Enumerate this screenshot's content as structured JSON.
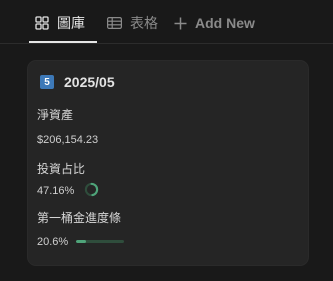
{
  "tabs": [
    {
      "label": "圖庫",
      "icon": "gallery-grid-icon",
      "active": true
    },
    {
      "label": "表格",
      "icon": "table-icon",
      "active": false
    },
    {
      "label": "Add New",
      "icon": "plus-icon",
      "active": false
    }
  ],
  "card": {
    "badge": "5",
    "title": "2025/05",
    "props": [
      {
        "label": "淨資產",
        "value": "$206,154.23"
      },
      {
        "label": "投資占比",
        "value": "47.16%",
        "progress": 0.4716
      },
      {
        "label": "第一桶金進度條",
        "value": "20.6%",
        "progress": 0.206
      }
    ]
  },
  "colors": {
    "accent_green": "#4fa47a",
    "badge_blue": "#3d79b8",
    "background": "#191919",
    "card": "#252525"
  }
}
